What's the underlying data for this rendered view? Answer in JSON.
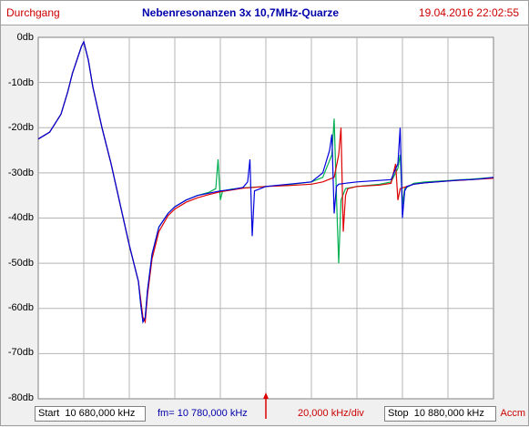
{
  "header": {
    "left": "Durchgang",
    "title": "Nebenresonanzen  3x 10,7MHz-Quarze",
    "datetime": "19.04.2016 22:02:55"
  },
  "footer": {
    "start_label": "Start",
    "start_value": "10 680,000 kHz",
    "fm_label": "fm=",
    "fm_value": "10 780,000 kHz",
    "div_value": "20,000 kHz/div",
    "stop_label": "Stop",
    "stop_value": "10 880,000 kHz",
    "accm": "Accm"
  },
  "colors": {
    "blue": "#0000dd",
    "red": "#dd0000",
    "green": "#00b050",
    "grid": "#b4b4b4"
  },
  "chart_data": {
    "type": "line",
    "x_unit": "kHz",
    "xlim": [
      10680,
      10880
    ],
    "ylim": [
      -80,
      0
    ],
    "ytick_labels": [
      "0db",
      "-10db",
      "-20db",
      "-30db",
      "-40db",
      "-50db",
      "-60db",
      "-70db",
      "-80db"
    ],
    "grid": true,
    "marker_x": 10780,
    "series": [
      {
        "color": "blue",
        "x": [
          10680,
          10685,
          10690,
          10693,
          10695,
          10697,
          10699,
          10700,
          10702,
          10704,
          10708,
          10712,
          10716,
          10720,
          10724,
          10725,
          10726,
          10727,
          10728,
          10730,
          10733,
          10737,
          10740,
          10745,
          10750,
          10755,
          10760,
          10765,
          10770,
          10772,
          10773,
          10774,
          10775,
          10780,
          10790,
          10800,
          10805,
          10808,
          10809,
          10810,
          10811,
          10812,
          10815,
          10820,
          10835,
          10838,
          10839,
          10840,
          10841,
          10842,
          10845,
          10850,
          10855,
          10860,
          10865,
          10870,
          10875,
          10880
        ],
        "y": [
          -22.5,
          -21,
          -17,
          -12,
          -8,
          -5,
          -2,
          -1,
          -5,
          -11,
          -20,
          -28,
          -37,
          -46,
          -54,
          -59,
          -63,
          -62,
          -56,
          -48,
          -42,
          -39,
          -37.5,
          -36,
          -35,
          -34.5,
          -34,
          -33.7,
          -33.2,
          -32,
          -27,
          -44,
          -34,
          -33,
          -32.5,
          -32,
          -30,
          -25,
          -21.5,
          -39,
          -33,
          -32.5,
          -32.3,
          -32,
          -31.5,
          -28,
          -20,
          -40,
          -34,
          -33,
          -32.5,
          -32.2,
          -32,
          -31.8,
          -31.6,
          -31.5,
          -31.3,
          -31
        ]
      },
      {
        "color": "red",
        "x": [
          10680,
          10685,
          10690,
          10693,
          10695,
          10697,
          10699,
          10700,
          10702,
          10704,
          10708,
          10712,
          10716,
          10720,
          10724,
          10725,
          10726,
          10727,
          10728,
          10730,
          10733,
          10737,
          10740,
          10745,
          10750,
          10755,
          10760,
          10765,
          10770,
          10780,
          10790,
          10800,
          10805,
          10810,
          10812,
          10813,
          10814,
          10815,
          10816,
          10820,
          10830,
          10835,
          10837,
          10838,
          10839,
          10845,
          10850,
          10860,
          10870,
          10880
        ],
        "y": [
          -22.5,
          -21,
          -17,
          -12,
          -8,
          -5,
          -2,
          -1,
          -5,
          -11,
          -20,
          -28,
          -37,
          -46,
          -54,
          -58,
          -62,
          -63,
          -57,
          -49,
          -43,
          -39.5,
          -38,
          -36.5,
          -35.5,
          -34.8,
          -34.2,
          -33.8,
          -33.4,
          -33,
          -32.8,
          -32.5,
          -32,
          -31,
          -26,
          -20,
          -43,
          -35,
          -33.5,
          -33,
          -32.7,
          -32.3,
          -28,
          -36,
          -33.5,
          -32.5,
          -32.2,
          -31.8,
          -31.5,
          -31.2
        ]
      },
      {
        "color": "green",
        "x": [
          10680,
          10685,
          10690,
          10693,
          10695,
          10697,
          10699,
          10700,
          10702,
          10704,
          10708,
          10712,
          10716,
          10720,
          10724,
          10725,
          10726,
          10727,
          10728,
          10730,
          10733,
          10737,
          10740,
          10745,
          10750,
          10755,
          10758,
          10759,
          10760,
          10761,
          10765,
          10770,
          10780,
          10790,
          10800,
          10805,
          10809,
          10810,
          10811,
          10812,
          10813,
          10815,
          10820,
          10830,
          10835,
          10838,
          10839,
          10840,
          10841,
          10845,
          10850,
          10860,
          10870,
          10880
        ],
        "y": [
          -22.5,
          -21,
          -17,
          -12,
          -8,
          -5,
          -2,
          -1,
          -5,
          -11,
          -20,
          -28,
          -37,
          -46,
          -54,
          -59,
          -63,
          -62,
          -56,
          -48,
          -42,
          -39,
          -37.5,
          -36,
          -35,
          -34.3,
          -33.5,
          -27,
          -36,
          -34,
          -33.6,
          -33.3,
          -33,
          -32.6,
          -32,
          -31,
          -26,
          -18,
          -35,
          -50,
          -36,
          -33.5,
          -33,
          -32.5,
          -32,
          -29,
          -26,
          -37,
          -33.5,
          -32.3,
          -32,
          -31.7,
          -31.4,
          -31
        ]
      }
    ]
  }
}
